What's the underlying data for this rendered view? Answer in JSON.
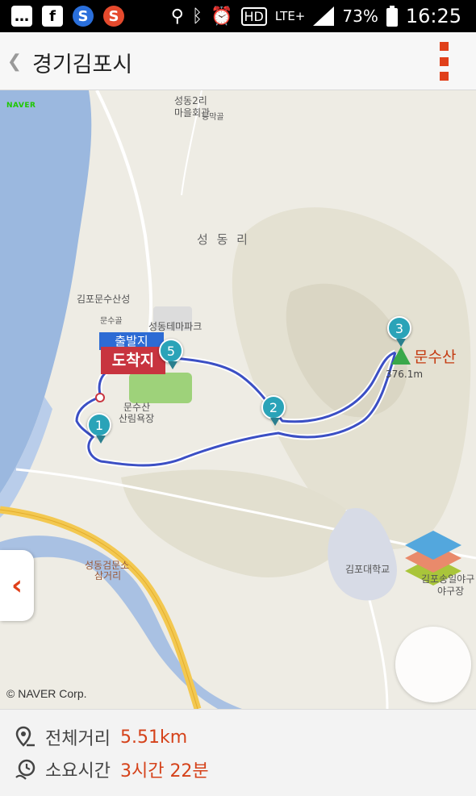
{
  "status_bar": {
    "left_icons": [
      "message-icon",
      "facebook-icon",
      "s-blue-icon",
      "s-red-icon"
    ],
    "right_icons": [
      "location-icon",
      "bluetooth-icon",
      "alarm-icon",
      "hd-icon",
      "lte-icon",
      "signal-icon",
      "battery-icon"
    ],
    "network": "LTE+",
    "hd": "HD",
    "battery": "73%",
    "time": "16:25"
  },
  "app_bar": {
    "back_icon": "back-chevron-icon",
    "title": "경기김포시",
    "menu_icon": "more-vertical-icon",
    "accent": "#e0401a"
  },
  "map": {
    "provider_tag": "NAVER",
    "copyright": "© NAVER Corp.",
    "labels": {
      "seongdong2ri": "성동2리",
      "maeulhoegwan": "마을회관",
      "deungmakgol": "등막골",
      "seongdongri": "성 동 리",
      "gimpo_munsusanseong": "김포문수산성",
      "munsugol": "문수골",
      "seongdong_themepark": "성동테마파크",
      "munsusan_forest_line1": "문수산",
      "munsusan_forest_line2": "산림욕장",
      "munsusan_peak": "문수산",
      "elevation": "376.1m",
      "seongdong_checkpoint_line1": "성동검문소",
      "seongdong_checkpoint_line2": "삼거리",
      "gimpo_college": "김포대학교",
      "gimpo_ballpark_line1": "김포송일야구",
      "gimpo_ballpark_line2": "야구장"
    },
    "start_flag": "출발지",
    "end_flag": "도착지",
    "waypoints": [
      "1",
      "2",
      "3",
      "5"
    ],
    "route_color": "#3b4fc4",
    "side_tab_icon": "chevron-left-icon",
    "layer_icon": "layers-icon"
  },
  "info": {
    "distance_icon": "route-pin-icon",
    "distance_label": "전체거리",
    "distance_value": "5.51km",
    "time_icon": "clock-walk-icon",
    "time_label": "소요시간",
    "time_value": "3시간 22분",
    "value_color": "#d5421a"
  }
}
